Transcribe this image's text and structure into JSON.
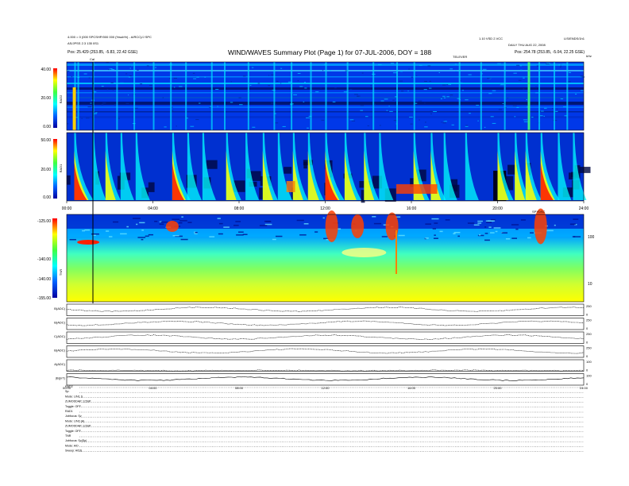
{
  "header": {
    "title": "WIND/WAVES Summary Plot (Page 1) for 07-JUL-2006, DOY = 188",
    "top_left_line1": "4.000 = 0 (000 SPCSHP/000 000 (%sub%) - A/RCC)/J SPC",
    "top_left_line2": "AS/JPSS 2.3 135 0S1",
    "top_left_line3": "Pos: 25.429 (253.85, -5.83, 22.42 GSE)",
    "top_right_line1": "1.10 VSD 2.VCC",
    "top_right_line2": "DAILY THU AUG 22, 2008",
    "top_right_line3": "Pos: 254.78 (253.85, -5.04, 22.25 GSE)",
    "corner_label": "LIS/ENDS/1h1",
    "tnr_mark_label": "TELEVER",
    "rad2_mark": "Cal"
  },
  "chart_data": [
    {
      "type": "heatmap",
      "name": "RAD2",
      "ylabel": "RAD2",
      "yticks": [
        "0.00",
        "20.00",
        "40.00"
      ],
      "ylim": [
        0,
        40
      ]
    },
    {
      "type": "heatmap",
      "name": "RAD1",
      "ylabel": "RAD1",
      "yticks": [
        "0.00",
        "20.00",
        "50.00"
      ],
      "ylim": [
        0,
        50
      ],
      "xticks": [
        "00:00",
        "04:00",
        "08:00",
        "12:00",
        "16:00",
        "20:00",
        "24:00"
      ]
    },
    {
      "type": "heatmap",
      "name": "TNR",
      "ylabel": "TNR",
      "yticks": [
        "-125.00",
        "-140.00",
        "-140.00",
        "-155.00"
      ],
      "right_ticks": [
        "100",
        "10"
      ],
      "mark_label": "SPYDSC"
    },
    {
      "type": "line",
      "name": "B",
      "panels": [
        {
          "label": "B(ADC)",
          "right": [
            "250",
            "0"
          ]
        },
        {
          "label": "B(ADC)",
          "right": [
            "250",
            "0"
          ]
        },
        {
          "label": "C(ADC)",
          "right": [
            "250",
            "0"
          ]
        },
        {
          "label": "B(ADC)",
          "right": [
            "250",
            "0"
          ]
        },
        {
          "label": "A(ADC)",
          "right": [
            "100",
            "0"
          ]
        },
        {
          "label": "|B|(nT)",
          "right": [
            "100",
            "0"
          ]
        }
      ],
      "xticks": [
        "00:00",
        "04:00",
        "08:00",
        "12:00",
        "16:00",
        "20:00",
        "24:00"
      ]
    }
  ],
  "bottom_text": {
    "rad2": [
      "RAD2",
      "Sp:",
      "Mode: LIN1 S",
      "ZUMODDAP: 3.5SP",
      "Toggle: OFF"
    ],
    "rad1": [
      "RAD1",
      "Jobfocus: Sv",
      "Mode: LIN2 (A)",
      "ZUMODDAP: 3.5SP",
      "Toggle: OFF"
    ],
    "tnr": [
      "TNR",
      "Jobfocus: Sv(Sp)",
      "Mode: A/D",
      "Sweep: A/DS"
    ]
  },
  "colors": {
    "bg_dark": "#001a8c",
    "bg_mid": "#0040ff",
    "cyan": "#00ffff",
    "green": "#00ff60",
    "yellow": "#ffff00",
    "red": "#ff2000"
  }
}
